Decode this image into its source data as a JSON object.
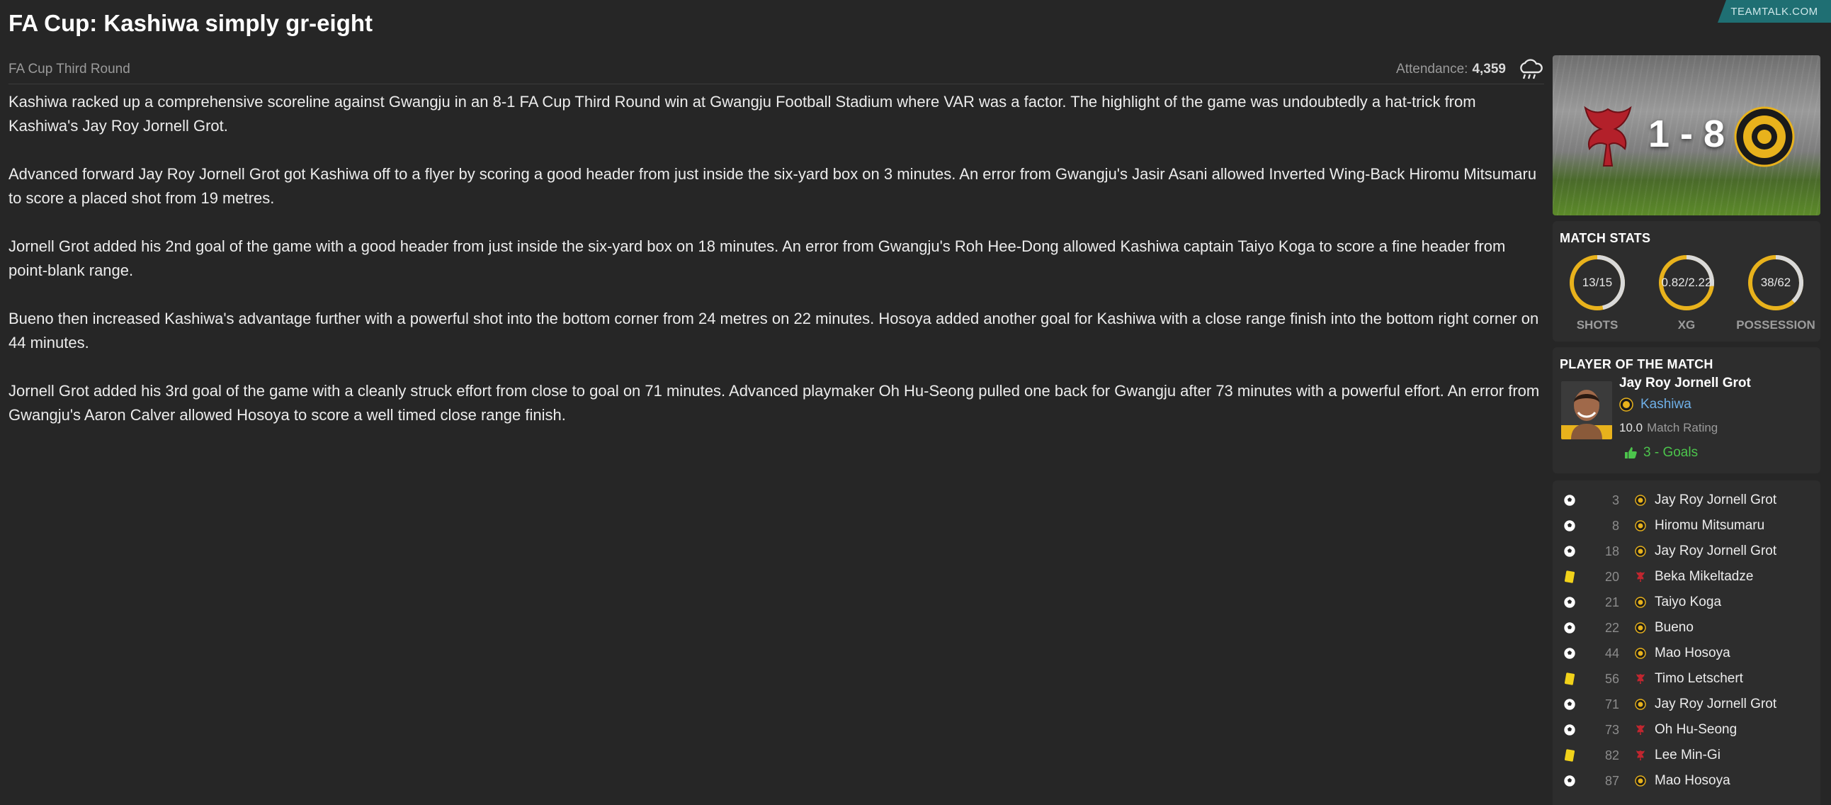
{
  "headline": "FA Cup: Kashiwa simply gr-eight",
  "source_tag": "TEAMTALK.COM",
  "meta": {
    "round": "FA Cup Third Round",
    "attendance_label": "Attendance:",
    "attendance_value": "4,359",
    "weather_icon": "rain-cloud-icon"
  },
  "paragraphs": [
    "Kashiwa racked up a comprehensive scoreline against Gwangju in an 8-1 FA Cup Third Round win at Gwangju Football Stadium where VAR was a factor. The highlight of the game was undoubtedly a hat-trick from Kashiwa's Jay Roy Jornell Grot.",
    "Advanced forward Jay Roy Jornell Grot got Kashiwa off to a flyer by scoring a good header from just inside the six-yard box on 3 minutes. An error from Gwangju's Jasir Asani allowed Inverted Wing-Back Hiromu Mitsumaru to score a placed shot from 19 metres.",
    "Jornell Grot added his 2nd goal of the game with a good header from just inside the six-yard box on 18 minutes. An error from Gwangju's Roh Hee-Dong allowed Kashiwa captain Taiyo Koga to score a fine header from point-blank range.",
    "Bueno then increased Kashiwa's advantage further with a powerful shot into the bottom corner from 24 metres on 22 minutes. Hosoya added another goal for Kashiwa with a close range finish into the bottom right corner on 44 minutes.",
    "Jornell Grot added his 3rd goal of the game with a cleanly struck effort from close to goal on 71 minutes. Advanced playmaker Oh Hu-Seong pulled one back for Gwangju after 73 minutes with a powerful effort. An error from Gwangju's Aaron Calver allowed Hosoya to score a well timed close range finish."
  ],
  "score": {
    "display": "1 - 8",
    "home_crest": "phoenix-crest-icon",
    "away_crest": "kashiwa-crest-icon"
  },
  "match_stats": {
    "title": "MATCH STATS",
    "rings": [
      {
        "label": "SHOTS",
        "value": "13/15",
        "home": 13,
        "away": 15
      },
      {
        "label": "XG",
        "value": "0.82/2.22",
        "home": 0.82,
        "away": 2.22
      },
      {
        "label": "POSSESSION",
        "value": "38/62",
        "home": 38,
        "away": 62
      }
    ],
    "colors": {
      "home": "#d9d9d9",
      "away": "#e8b21c"
    }
  },
  "potm": {
    "title": "PLAYER OF THE MATCH",
    "name": "Jay Roy Jornell Grot",
    "club": "Kashiwa",
    "rating": "10.0",
    "rating_label": "Match Rating",
    "goals": "3 - Goals"
  },
  "events": [
    {
      "type": "goal",
      "minute": "3",
      "team": "away",
      "player": "Jay Roy Jornell Grot"
    },
    {
      "type": "goal",
      "minute": "8",
      "team": "away",
      "player": "Hiromu Mitsumaru"
    },
    {
      "type": "goal",
      "minute": "18",
      "team": "away",
      "player": "Jay Roy Jornell Grot"
    },
    {
      "type": "yellow",
      "minute": "20",
      "team": "home",
      "player": "Beka Mikeltadze"
    },
    {
      "type": "goal",
      "minute": "21",
      "team": "away",
      "player": "Taiyo Koga"
    },
    {
      "type": "goal",
      "minute": "22",
      "team": "away",
      "player": "Bueno"
    },
    {
      "type": "goal",
      "minute": "44",
      "team": "away",
      "player": "Mao Hosoya"
    },
    {
      "type": "yellow",
      "minute": "56",
      "team": "home",
      "player": "Timo Letschert"
    },
    {
      "type": "goal",
      "minute": "71",
      "team": "away",
      "player": "Jay Roy Jornell Grot"
    },
    {
      "type": "goal",
      "minute": "73",
      "team": "home",
      "player": "Oh Hu-Seong"
    },
    {
      "type": "yellow",
      "minute": "82",
      "team": "home",
      "player": "Lee Min-Gi"
    },
    {
      "type": "goal",
      "minute": "87",
      "team": "away",
      "player": "Mao Hosoya"
    }
  ]
}
